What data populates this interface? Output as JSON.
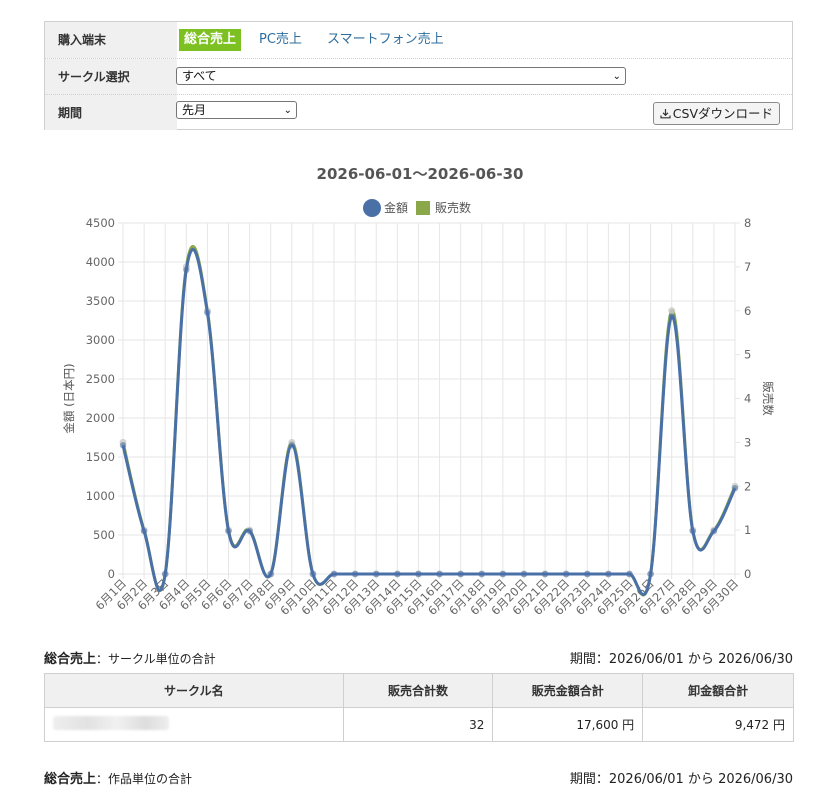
{
  "filters": {
    "device_label": "購入端末",
    "device_tabs": [
      "総合売上",
      "PC売上",
      "スマートフォン売上"
    ],
    "circle_label": "サークル選択",
    "circle_value": "すべて",
    "period_label": "期間",
    "period_value": "先月",
    "csv_label": "CSVダウンロード"
  },
  "chart_data": {
    "type": "line",
    "title": "2026-06-01〜2026-06-30",
    "categories": [
      "6月1日",
      "6月2日",
      "6月3日",
      "6月4日",
      "6月5日",
      "6月6日",
      "6月7日",
      "6月8日",
      "6月9日",
      "6月10日",
      "6月11日",
      "6月12日",
      "6月13日",
      "6月14日",
      "6月15日",
      "6月16日",
      "6月17日",
      "6月18日",
      "6月19日",
      "6月20日",
      "6月21日",
      "6月22日",
      "6月23日",
      "6月24日",
      "6月25日",
      "6月26日",
      "6月27日",
      "6月28日",
      "6月29日",
      "6月30日"
    ],
    "series": [
      {
        "name": "金額",
        "axis": "left",
        "color": "#4a70a8",
        "values": [
          1650,
          550,
          0,
          3900,
          3350,
          550,
          550,
          0,
          1650,
          0,
          0,
          0,
          0,
          0,
          0,
          0,
          0,
          0,
          0,
          0,
          0,
          0,
          0,
          0,
          0,
          0,
          3300,
          550,
          550,
          1100
        ]
      },
      {
        "name": "販売数",
        "axis": "right",
        "color": "#8aa84a",
        "values": [
          3,
          1,
          0,
          7,
          6,
          1,
          1,
          0,
          3,
          0,
          0,
          0,
          0,
          0,
          0,
          0,
          0,
          0,
          0,
          0,
          0,
          0,
          0,
          0,
          0,
          0,
          6,
          1,
          1,
          2
        ]
      }
    ],
    "ylabel": "金額 (日本円)",
    "y2label": "販売数",
    "ylim": [
      0,
      4500
    ],
    "y2lim": [
      0,
      8
    ],
    "yticks": [
      "0",
      "500",
      "1000",
      "1500",
      "2000",
      "2500",
      "3000",
      "3500",
      "4000",
      "4500"
    ],
    "y2ticks": [
      "0",
      "1",
      "2",
      "3",
      "4",
      "5",
      "6",
      "7",
      "8"
    ],
    "grid": true,
    "legend": "top-center"
  },
  "summary1": {
    "title": "総合売上",
    "subtitle": "：サークル単位の合計",
    "period": "期間：2026/06/01 から 2026/06/30",
    "headers": [
      "サークル名",
      "販売合計数",
      "販売金額合計",
      "卸金額合計"
    ],
    "row": {
      "count": "32",
      "amount": "17,600 円",
      "wholesale": "9,472 円"
    }
  },
  "summary2": {
    "title": "総合売上",
    "subtitle": "：作品単位の合計",
    "period": "期間：2026/06/01 から 2026/06/30"
  }
}
